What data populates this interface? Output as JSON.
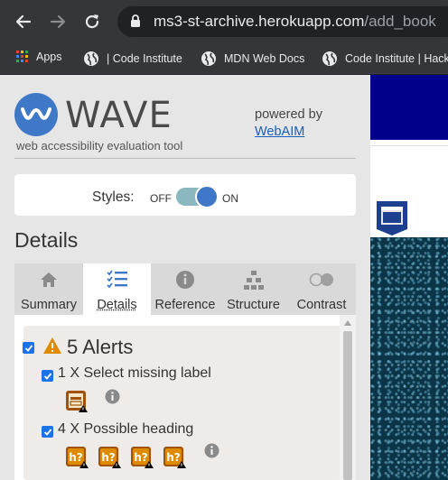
{
  "browser": {
    "url_host": "ms3-st-archive.herokuapp.com",
    "url_path": "/add_book",
    "bookmarks": [
      {
        "label": "Apps"
      },
      {
        "label": "| Code Institute"
      },
      {
        "label": "MDN Web Docs"
      },
      {
        "label": "Code Institute | Hacka"
      }
    ]
  },
  "wave": {
    "brand": "WAVE",
    "tagline": "web accessibility evaluation tool",
    "powered_by": "powered by",
    "webaim_link": "WebAIM",
    "styles": {
      "label": "Styles:",
      "off": "OFF",
      "on": "ON",
      "state": "on"
    },
    "section_title": "Details",
    "tabs": [
      {
        "label": "Summary",
        "icon": "home-icon",
        "active": false
      },
      {
        "label": "Details",
        "icon": "list-icon",
        "active": true
      },
      {
        "label": "Reference",
        "icon": "info-icon",
        "active": false
      },
      {
        "label": "Structure",
        "icon": "hierarchy-icon",
        "active": false
      },
      {
        "label": "Contrast",
        "icon": "contrast-icon",
        "active": false
      }
    ],
    "alerts": {
      "title": "5 Alerts",
      "checked": true,
      "items": [
        {
          "label": "1 X Select missing label",
          "checked": true,
          "icon": "select-missing-label-icon",
          "count": 1
        },
        {
          "label": "4 X Possible heading",
          "checked": true,
          "icon": "possible-heading-icon",
          "count": 4
        }
      ]
    }
  },
  "colors": {
    "wave_blue": "#3e78c7",
    "alert_orange": "#e08a00",
    "alert_icon_brown": "#a0520a",
    "checkbox_blue": "#1a73e8",
    "page_nav": "#00008b"
  }
}
